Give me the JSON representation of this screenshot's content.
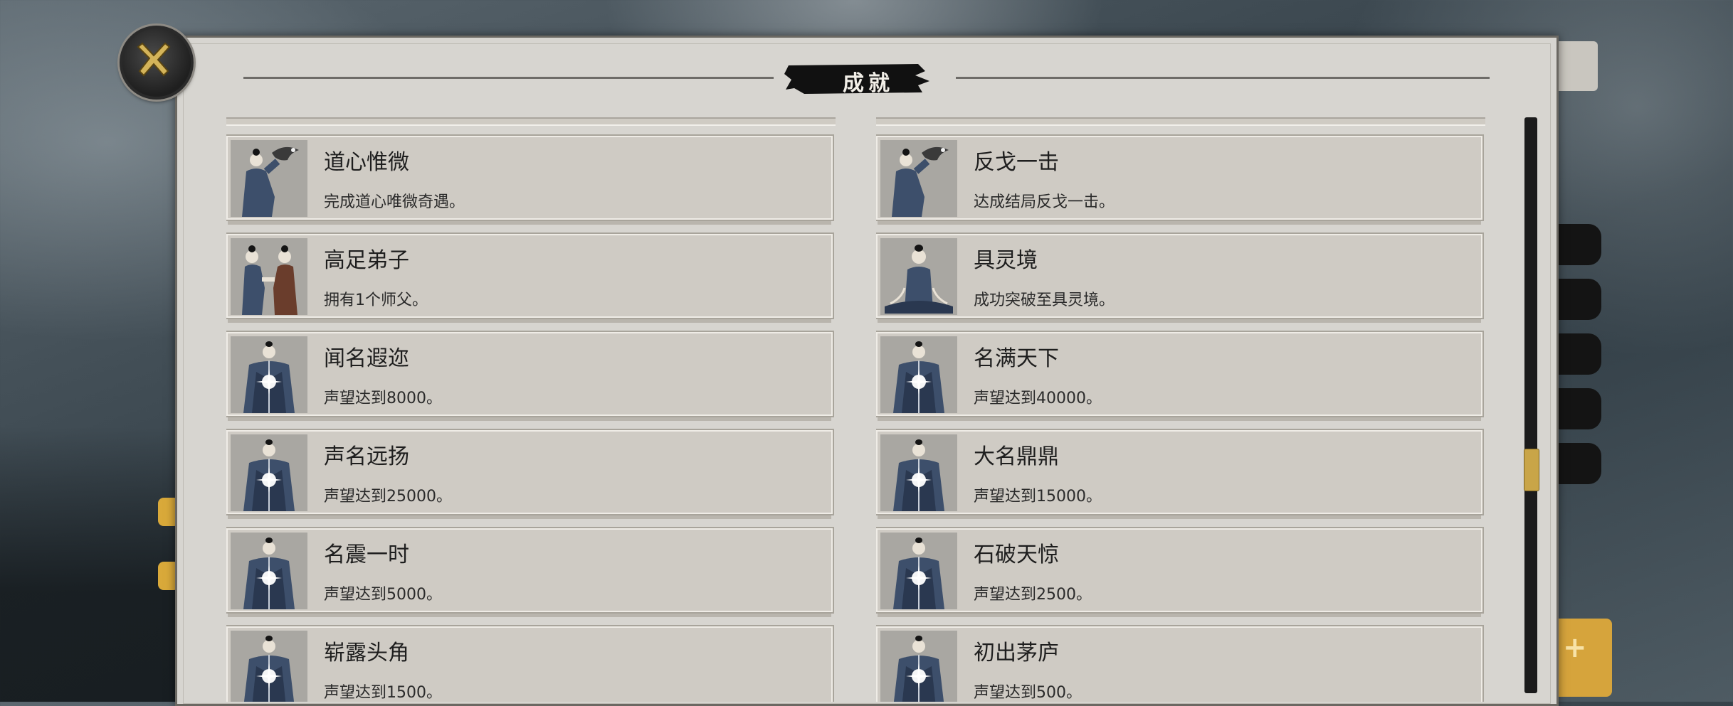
{
  "title": "成就",
  "close_button": {
    "icon": "close-x-icon"
  },
  "colors": {
    "panel": "#d7d5d0",
    "card": "#cfcbc4",
    "accent_gold": "#c9a548",
    "title_brush": "#111111"
  },
  "achievements": {
    "left": [
      {
        "title": "道心惟微",
        "desc": "完成道心唯微奇遇。",
        "icon": "scholar-with-bird-icon"
      },
      {
        "title": "高足弟子",
        "desc": "拥有1个师父。",
        "icon": "master-disciple-icon"
      },
      {
        "title": "闻名遐迩",
        "desc": "声望达到8000。",
        "icon": "glowing-robed-figure-icon"
      },
      {
        "title": "声名远扬",
        "desc": "声望达到25000。",
        "icon": "glowing-robed-figure-icon"
      },
      {
        "title": "名震一时",
        "desc": "声望达到5000。",
        "icon": "glowing-robed-figure-icon"
      },
      {
        "title": "崭露头角",
        "desc": "声望达到1500。",
        "icon": "glowing-robed-figure-icon"
      }
    ],
    "right": [
      {
        "title": "反戈一击",
        "desc": "达成结局反戈一击。",
        "icon": "scholar-with-bird-icon"
      },
      {
        "title": "具灵境",
        "desc": "成功突破至具灵境。",
        "icon": "meditating-figure-icon"
      },
      {
        "title": "名满天下",
        "desc": "声望达到40000。",
        "icon": "glowing-robed-figure-icon"
      },
      {
        "title": "大名鼎鼎",
        "desc": "声望达到15000。",
        "icon": "glowing-robed-figure-icon"
      },
      {
        "title": "石破天惊",
        "desc": "声望达到2500。",
        "icon": "glowing-robed-figure-icon"
      },
      {
        "title": "初出茅庐",
        "desc": "声望达到500。",
        "icon": "glowing-robed-figure-icon"
      }
    ]
  },
  "scroll": {
    "position": 0.62
  }
}
